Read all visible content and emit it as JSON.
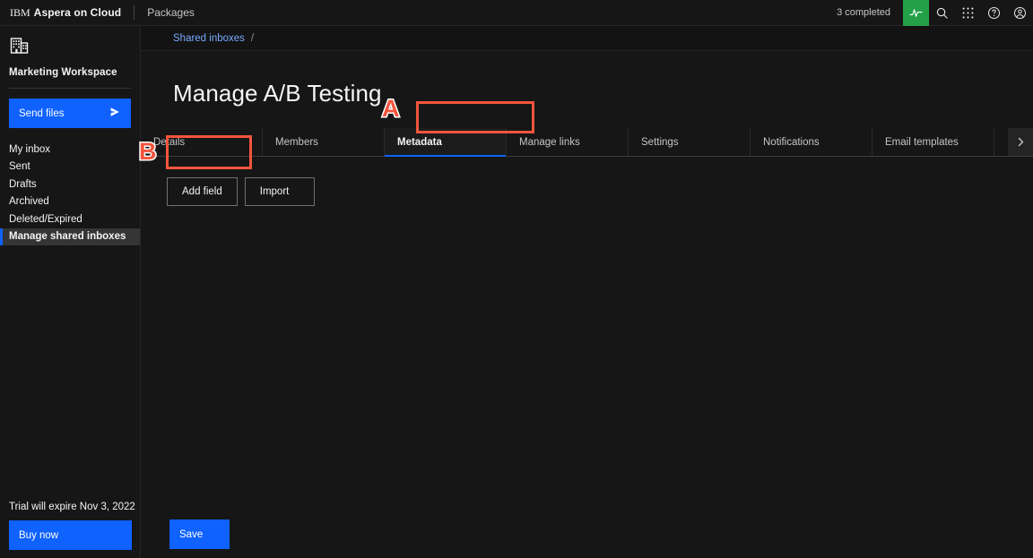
{
  "topbar": {
    "brand_ibm": "IBM",
    "brand_product": "Aspera on Cloud",
    "nav_packages": "Packages",
    "completed_status": "3 completed",
    "icons": {
      "activity": "activity-icon",
      "search": "search-icon",
      "app_switcher": "app-switcher-icon",
      "help": "help-icon",
      "account": "account-icon"
    },
    "accent_green": "#24a148"
  },
  "sidebar": {
    "workspace_icon": "building-icon",
    "workspace_name": "Marketing Workspace",
    "send_files_label": "Send files",
    "send_files_icon": "send-icon",
    "items": [
      {
        "label": "My inbox",
        "active": false
      },
      {
        "label": "Sent",
        "active": false
      },
      {
        "label": "Drafts",
        "active": false
      },
      {
        "label": "Archived",
        "active": false
      },
      {
        "label": "Deleted/Expired",
        "active": false
      },
      {
        "label": "Manage shared inboxes",
        "active": true
      }
    ],
    "trial_notice": "Trial will expire Nov 3, 2022",
    "buy_now_label": "Buy now",
    "accent_blue": "#0f62fe"
  },
  "main": {
    "breadcrumb": {
      "label": "Shared inboxes",
      "separator": "/"
    },
    "page_title": "Manage A/B Testing",
    "tabs": [
      {
        "label": "Details",
        "active": false
      },
      {
        "label": "Members",
        "active": false
      },
      {
        "label": "Metadata",
        "active": true
      },
      {
        "label": "Manage links",
        "active": false
      },
      {
        "label": "Settings",
        "active": false
      },
      {
        "label": "Notifications",
        "active": false
      },
      {
        "label": "Email templates",
        "active": false
      }
    ],
    "tab_overflow_icon": "chevron-right-icon",
    "actions": {
      "add_field_label": "Add field",
      "import_label": "Import"
    },
    "save_label": "Save"
  },
  "annotations": {
    "color": "#f4553d",
    "markers": [
      {
        "letter": "A",
        "target": "metadata-tab"
      },
      {
        "letter": "B",
        "target": "add-field-button"
      }
    ]
  }
}
